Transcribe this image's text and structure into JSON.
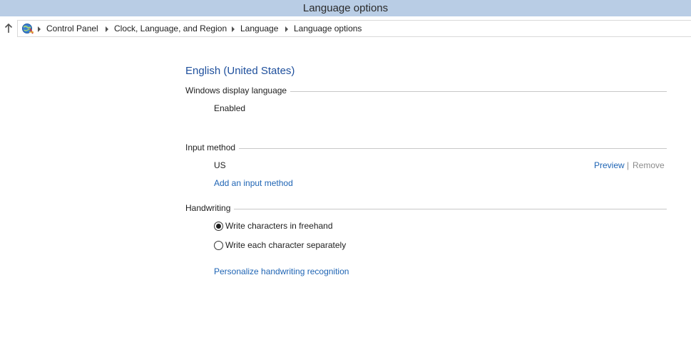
{
  "window": {
    "title": "Language options"
  },
  "breadcrumb": {
    "items": [
      "Control Panel",
      "Clock, Language, and Region",
      "Language",
      "Language options"
    ]
  },
  "icons": {
    "up": "arrow-up-icon",
    "control_panel": "control-panel-icon",
    "separator": "chevron-right-icon"
  },
  "language": {
    "name": "English (United States)"
  },
  "display_language": {
    "heading": "Windows display language",
    "status": "Enabled"
  },
  "input_method": {
    "heading": "Input method",
    "method": "US",
    "preview_label": "Preview",
    "separator": "|",
    "remove_label": "Remove",
    "add_label": "Add an input method"
  },
  "handwriting": {
    "heading": "Handwriting",
    "options": [
      {
        "label": "Write characters in freehand",
        "selected": true
      },
      {
        "label": "Write each character separately",
        "selected": false
      }
    ],
    "personalize_label": "Personalize handwriting recognition"
  },
  "colors": {
    "titlebar_bg": "#b9cde5",
    "link": "#1e64b4",
    "heading": "#1e4f9c",
    "disabled": "#8c8c8c"
  }
}
